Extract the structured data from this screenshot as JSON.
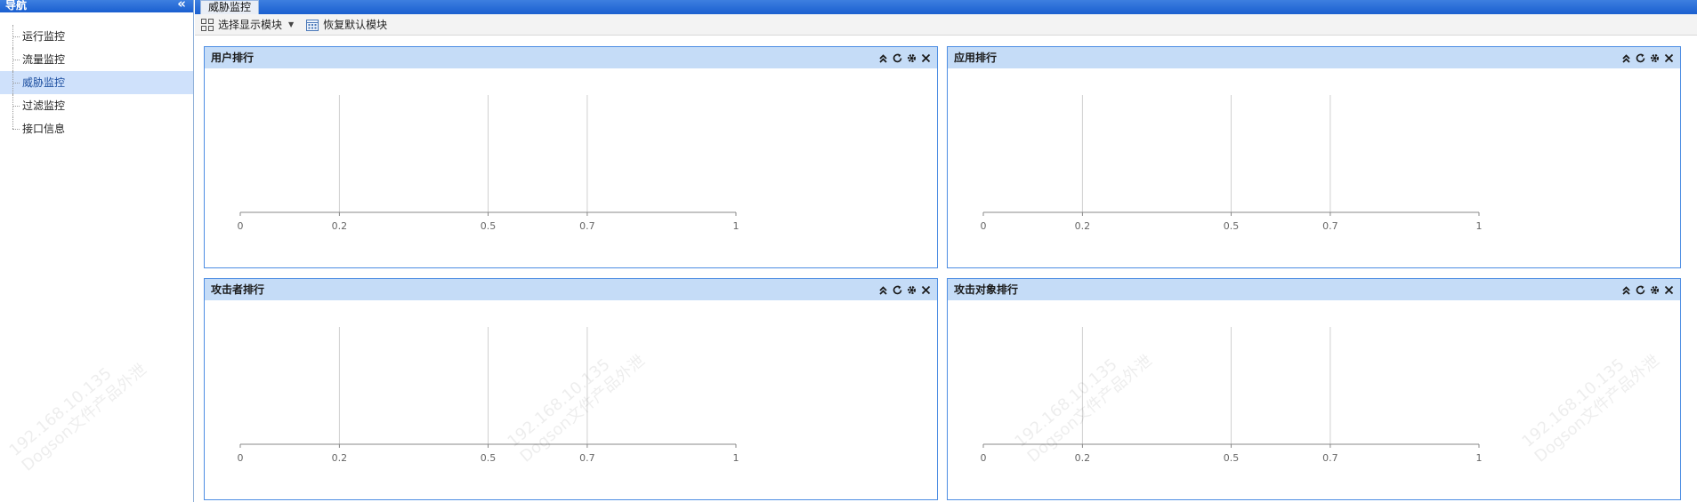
{
  "sidebar": {
    "title": "导航",
    "collapse_icon": "double-chevron-left-icon",
    "items": [
      {
        "label": "运行监控",
        "active": false
      },
      {
        "label": "流量监控",
        "active": false
      },
      {
        "label": "威胁监控",
        "active": true
      },
      {
        "label": "过滤监控",
        "active": false
      },
      {
        "label": "接口信息",
        "active": false
      }
    ]
  },
  "tabs": [
    {
      "label": "威胁监控"
    }
  ],
  "toolbar": {
    "select_modules_label": "选择显示模块",
    "restore_default_label": "恢复默认模块"
  },
  "panels": [
    {
      "title": "用户排行"
    },
    {
      "title": "应用排行"
    },
    {
      "title": "攻击者排行"
    },
    {
      "title": "攻击对象排行"
    }
  ],
  "watermark": {
    "ip": "192.168.10.135",
    "text": "Dogson文件产品外泄"
  },
  "chart_data": [
    {
      "type": "bar",
      "title": "用户排行",
      "categories": [],
      "values": [],
      "xlim": [
        0,
        1
      ],
      "x_ticks": [
        "0",
        "0.2",
        "0.5",
        "0.7",
        "1"
      ],
      "grid": true
    },
    {
      "type": "bar",
      "title": "应用排行",
      "categories": [],
      "values": [],
      "xlim": [
        0,
        1
      ],
      "x_ticks": [
        "0",
        "0.2",
        "0.5",
        "0.7",
        "1"
      ],
      "grid": true
    },
    {
      "type": "bar",
      "title": "攻击者排行",
      "categories": [],
      "values": [],
      "xlim": [
        0,
        1
      ],
      "x_ticks": [
        "0",
        "0.2",
        "0.5",
        "0.7",
        "1"
      ],
      "grid": true
    },
    {
      "type": "bar",
      "title": "攻击对象排行",
      "categories": [],
      "values": [],
      "xlim": [
        0,
        1
      ],
      "x_ticks": [
        "0",
        "0.2",
        "0.5",
        "0.7",
        "1"
      ],
      "grid": true
    }
  ]
}
